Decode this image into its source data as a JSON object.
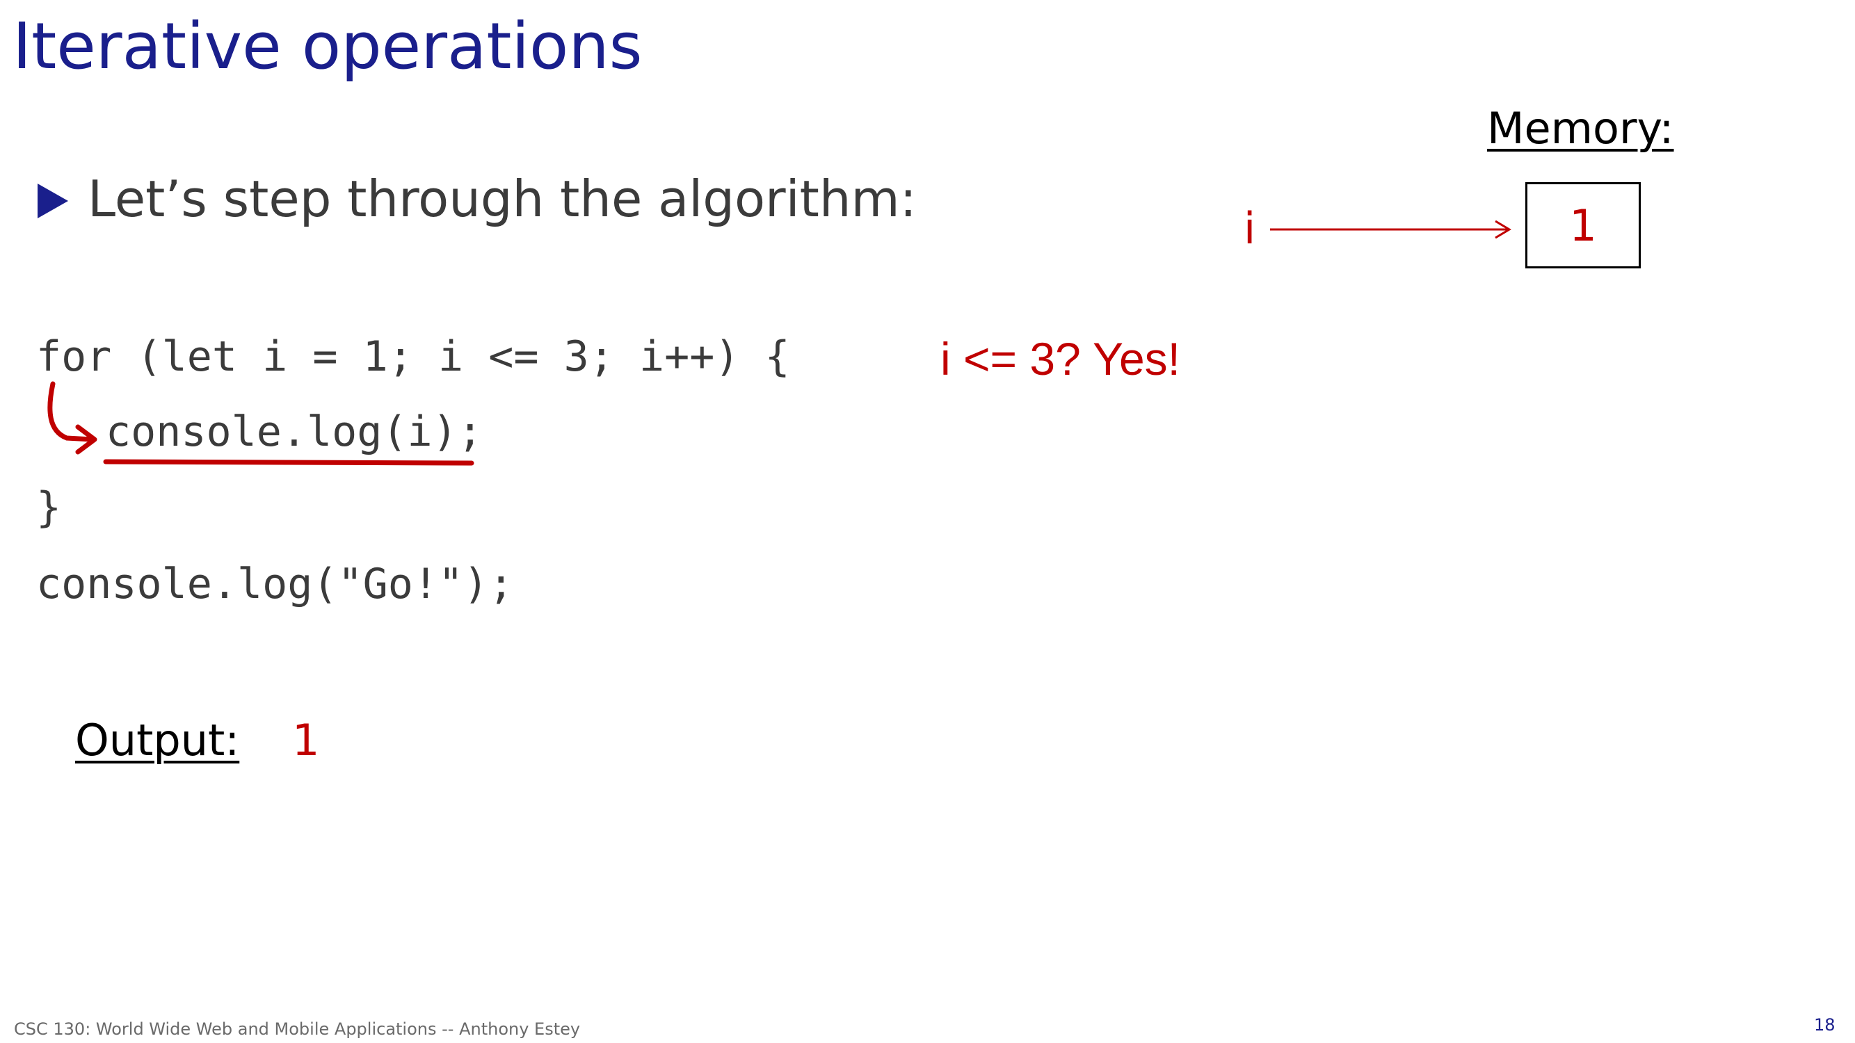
{
  "slide": {
    "title": "Iterative operations",
    "bullet": "Let’s step through the algorithm:"
  },
  "code": {
    "line1": "for (let i = 1; i <= 3; i++) {",
    "line2": "console.log(i);",
    "line3": "}",
    "line4": "console.log(\"Go!\");"
  },
  "annotation": {
    "condition": "i <= 3? Yes!"
  },
  "output": {
    "label": "Output:",
    "value": "1"
  },
  "memory": {
    "label": "Memory:",
    "variable": "i",
    "value": "1"
  },
  "footer": {
    "course": "CSC 130: World Wide Web and Mobile Applications -- Anthony Estey",
    "page_number": "18"
  },
  "colors": {
    "title": "#1a1f8c",
    "annotation": "#c00000",
    "body_text": "#3b3b3b"
  }
}
